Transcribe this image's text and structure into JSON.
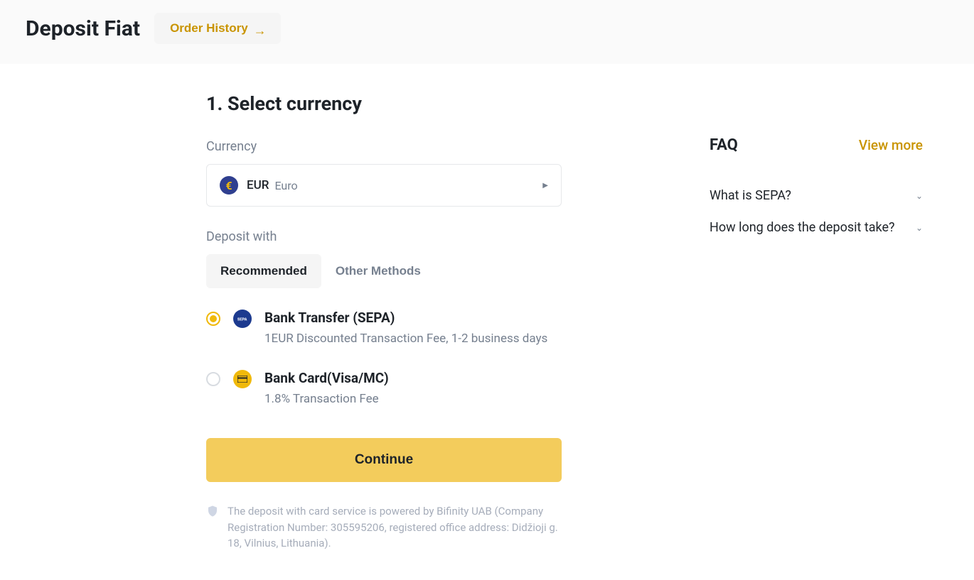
{
  "header": {
    "title": "Deposit Fiat",
    "order_history_label": "Order History"
  },
  "step": {
    "heading": "1. Select currency",
    "currency_label": "Currency",
    "currency_code": "EUR",
    "currency_name": "Euro",
    "deposit_with_label": "Deposit with"
  },
  "tabs": {
    "recommended": "Recommended",
    "other": "Other Methods"
  },
  "methods": [
    {
      "title": "Bank Transfer (SEPA)",
      "desc": "1EUR Discounted Transaction Fee, 1-2 business days",
      "selected": true,
      "icon_label": "SEPA"
    },
    {
      "title": "Bank Card(Visa/MC)",
      "desc": "1.8% Transaction Fee",
      "selected": false,
      "icon_label": "card"
    }
  ],
  "continue_label": "Continue",
  "disclaimer": "The deposit with card service is powered by Bifinity UAB (Company Registration Number: 305595206, registered office address: Didžioji g. 18, Vilnius, Lithuania).",
  "faq": {
    "title": "FAQ",
    "view_more": "View more",
    "items": [
      {
        "question": "What is SEPA?"
      },
      {
        "question": "How long does the deposit take?"
      }
    ]
  }
}
